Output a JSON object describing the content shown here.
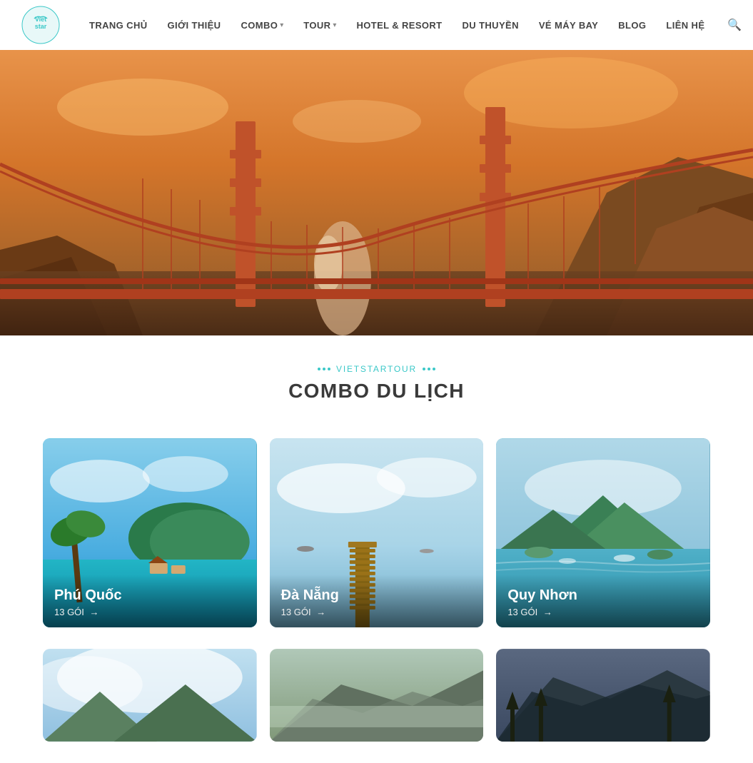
{
  "header": {
    "logo_alt": "Vietstar Logo",
    "nav_items": [
      {
        "label": "TRANG CHỦ",
        "href": "#",
        "dropdown": false
      },
      {
        "label": "GIỚI THIỆU",
        "href": "#",
        "dropdown": false
      },
      {
        "label": "COMBO",
        "href": "#",
        "dropdown": true
      },
      {
        "label": "TOUR",
        "href": "#",
        "dropdown": true
      },
      {
        "label": "HOTEL & RESORT",
        "href": "#",
        "dropdown": false
      },
      {
        "label": "DU THUYỀN",
        "href": "#",
        "dropdown": false
      },
      {
        "label": "VÉ MÁY BAY",
        "href": "#",
        "dropdown": false
      },
      {
        "label": "BLOG",
        "href": "#",
        "dropdown": false
      },
      {
        "label": "LIÊN HỆ",
        "href": "#",
        "dropdown": false
      }
    ]
  },
  "section": {
    "subtitle": "VIETSTARTOUR",
    "title": "COMBO DU LỊCH"
  },
  "cards": [
    {
      "id": "phu-quoc",
      "title": "Phú Quốc",
      "count": "13 GÓI",
      "css_class": "card-pq"
    },
    {
      "id": "da-nang",
      "title": "Đà Nẵng",
      "count": "13 GÓI",
      "css_class": "card-dn"
    },
    {
      "id": "quy-nhon",
      "title": "Quy Nhơn",
      "count": "13 GÓI",
      "css_class": "card-qn"
    }
  ],
  "cards_bottom": [
    {
      "id": "bottom1",
      "css_class": "card-bottom1"
    },
    {
      "id": "bottom2",
      "css_class": "card-bottom2"
    },
    {
      "id": "bottom3",
      "css_class": "card-bottom3"
    }
  ],
  "arrow": "→"
}
